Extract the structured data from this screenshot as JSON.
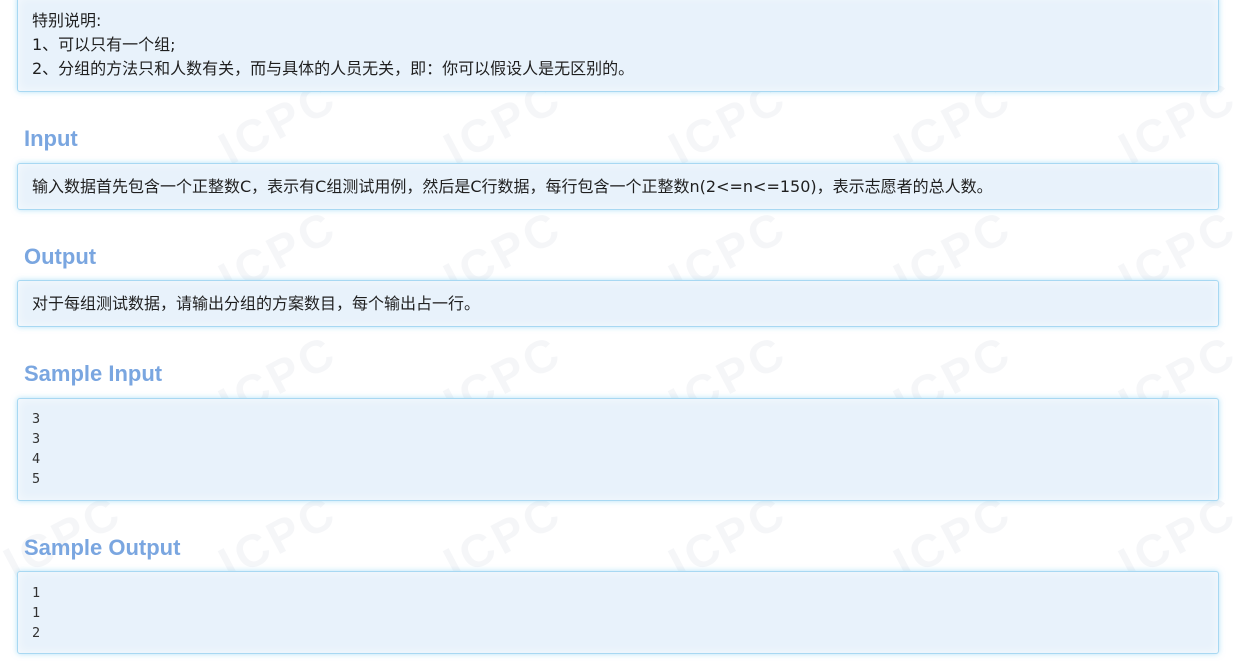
{
  "notes": {
    "title": "特别说明:",
    "items": [
      "1、可以只有一个组;",
      "2、分组的方法只和人数有关，而与具体的人员无关，即：你可以假设人是无区别的。"
    ]
  },
  "input": {
    "heading": "Input",
    "text": "输入数据首先包含一个正整数C，表示有C组测试用例，然后是C行数据，每行包含一个正整数n(2<=n<=150)，表示志愿者的总人数。"
  },
  "output": {
    "heading": "Output",
    "text": "对于每组测试数据，请输出分组的方案数目，每个输出占一行。"
  },
  "sample_input": {
    "heading": "Sample Input",
    "lines": [
      "3",
      "3",
      "4",
      "5"
    ]
  },
  "sample_output": {
    "heading": "Sample Output",
    "lines": [
      "1",
      "1",
      "2"
    ]
  },
  "watermark": {
    "text": "ICPC"
  },
  "colors": {
    "heading": "#7aa6e0",
    "box_bg": "#e8f2fb",
    "box_border": "#a8d8f2"
  }
}
